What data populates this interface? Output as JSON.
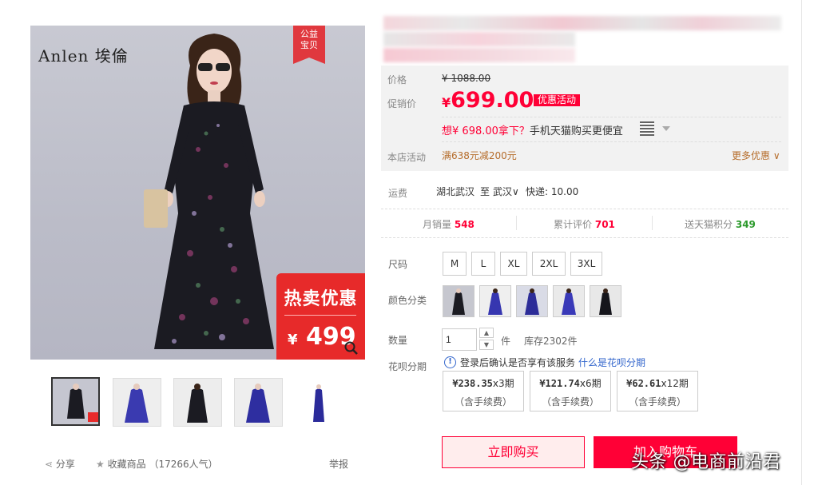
{
  "gallery": {
    "brand": "Anlen 埃倫",
    "charity_badge": [
      "公益",
      "宝贝"
    ],
    "promo_tag": {
      "title": "热卖优惠",
      "currency": "¥",
      "price": "499"
    },
    "thumbnails": 5,
    "share": "分享",
    "favorite": "收藏商品",
    "popularity": "（17266人气）",
    "report": "举报"
  },
  "price": {
    "label": "价格",
    "original": "¥ 1088.00",
    "promo_label": "促销价",
    "currency": "¥",
    "value": "699.00",
    "promo_badge": "优惠活动",
    "tmall_prefix": "想",
    "tmall_price": "¥ 698.00拿下？",
    "tmall_suffix": "手机天猫购买更便宜",
    "shop_activity_label": "本店活动",
    "shop_activity": "满638元减200元",
    "more_promo": "更多优惠"
  },
  "shipping": {
    "label": "运费",
    "from": "湖北武汉",
    "to_prefix": "至",
    "to": "武汉",
    "express": "快递: 10.00"
  },
  "stats": {
    "monthly_sales_label": "月销量",
    "monthly_sales": "548",
    "reviews_label": "累计评价",
    "reviews": "701",
    "points_label": "送天猫积分",
    "points": "349"
  },
  "options": {
    "size_label": "尺码",
    "sizes": [
      "M",
      "L",
      "XL",
      "2XL",
      "3XL"
    ],
    "color_label": "颜色分类",
    "quantity_label": "数量",
    "quantity": "1",
    "unit": "件",
    "stock": "库存2302件",
    "huabei_label": "花呗分期",
    "huabei_info": "登录后确认是否享有该服务",
    "huabei_link": "什么是花呗分期",
    "installments": [
      {
        "amount": "¥238.35",
        "term": "x3期",
        "note": "（含手续费）"
      },
      {
        "amount": "¥121.74",
        "term": "x6期",
        "note": "（含手续费）"
      },
      {
        "amount": "¥62.61",
        "term": "x12期",
        "note": "（含手续费）"
      }
    ]
  },
  "actions": {
    "buy_now": "立即购买",
    "add_cart": "加入购物车"
  },
  "watermark": "头条 @电商前沿君",
  "colors": {
    "accent": "#ff0036",
    "shop_activity": "#b56c2a",
    "points": "#2c9a2c",
    "link": "#3366cc"
  }
}
